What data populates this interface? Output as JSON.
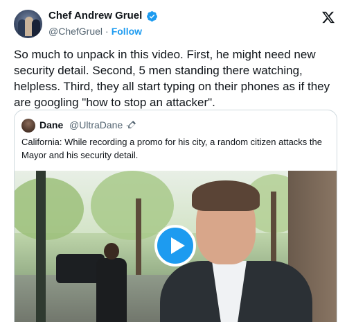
{
  "tweet": {
    "author_name": "Chef Andrew Gruel",
    "author_handle": "@ChefGruel",
    "separator": "·",
    "follow_label": "Follow",
    "verified_icon": "verified-badge-icon",
    "platform_icon": "x-logo-icon",
    "text": "So much to unpack in this video. First, he might need new security detail. Second, 5 men standing there watching, helpless. Third, they all start typing on their phones as if they are googling \"how to stop an attacker\"."
  },
  "quote": {
    "author_name": "Dane",
    "author_handle": "@UltraDane",
    "separator": "·",
    "edit_icon": "pencil-icon",
    "text": "California: While recording a promo for his city, a random citizen attacks the Mayor and his security detail.",
    "video": {
      "play_icon": "play-icon"
    }
  },
  "colors": {
    "accent": "#1d9bf0",
    "text_primary": "#0f1419",
    "text_secondary": "#536471",
    "border": "#cfd9de"
  }
}
